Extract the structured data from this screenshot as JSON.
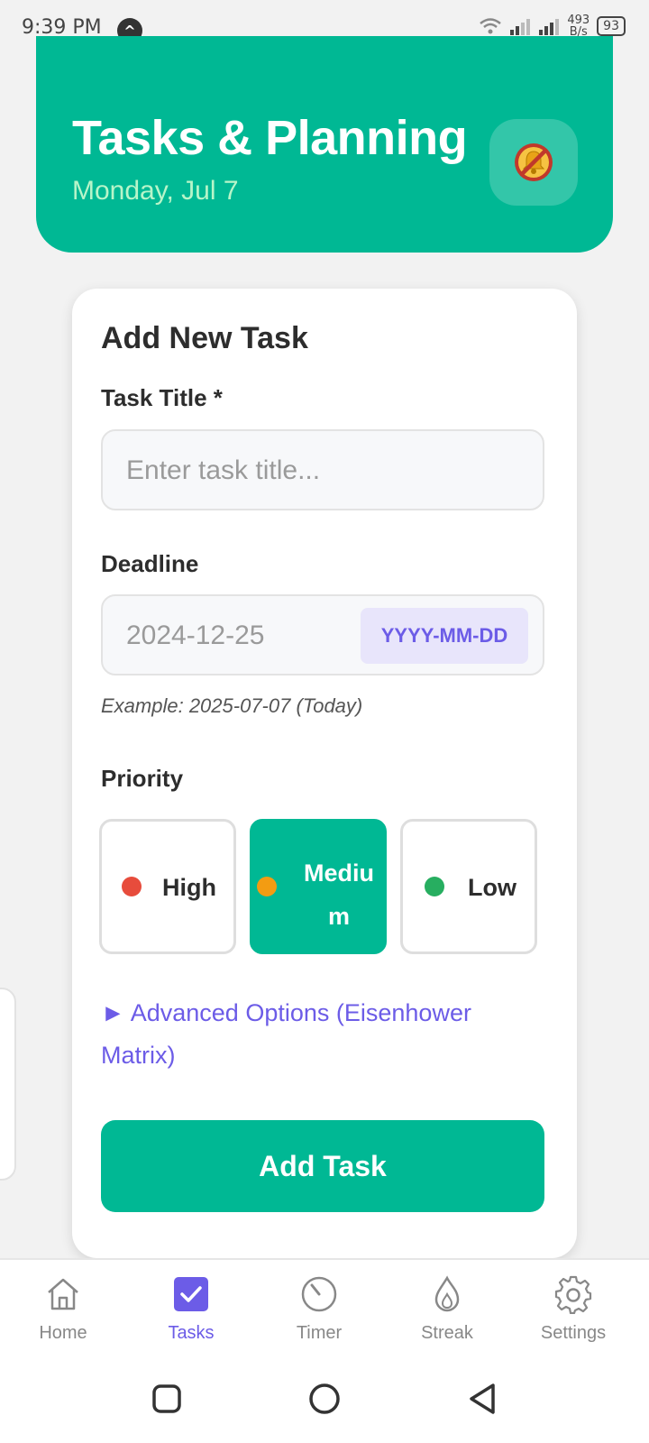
{
  "status_bar": {
    "time": "9:39 PM",
    "app_icon_glyph": "^",
    "net_speed_value": "493",
    "net_speed_unit": "B/s",
    "battery": "93"
  },
  "header": {
    "title": "Tasks & Planning",
    "date": "Monday, Jul 7",
    "bell_icon": "bell-muted-icon"
  },
  "form": {
    "heading": "Add New Task",
    "title_label": "Task Title *",
    "title_placeholder": "Enter task title...",
    "deadline_label": "Deadline",
    "deadline_placeholder": "2024-12-25",
    "deadline_format": "YYYY-MM-DD",
    "deadline_example": "Example: 2025-07-07 (Today)",
    "priority_label": "Priority",
    "priorities": [
      {
        "label": "High",
        "color": "#e74c3c",
        "selected": false
      },
      {
        "label": "Mediu m",
        "color": "#f39c12",
        "selected": true
      },
      {
        "label": "Low",
        "color": "#27ae60",
        "selected": false
      }
    ],
    "advanced_label": "► Advanced Options (Eisenhower Matrix)",
    "submit_label": "Add Task"
  },
  "nav": {
    "items": [
      {
        "label": "Home",
        "icon": "home-icon",
        "active": false
      },
      {
        "label": "Tasks",
        "icon": "checkbox-icon",
        "active": true
      },
      {
        "label": "Timer",
        "icon": "timer-icon",
        "active": false
      },
      {
        "label": "Streak",
        "icon": "flame-icon",
        "active": false
      },
      {
        "label": "Settings",
        "icon": "gear-icon",
        "active": false
      }
    ]
  },
  "colors": {
    "accent": "#00b894",
    "purple": "#6c5ce7",
    "header_date": "#b7f5c9"
  }
}
